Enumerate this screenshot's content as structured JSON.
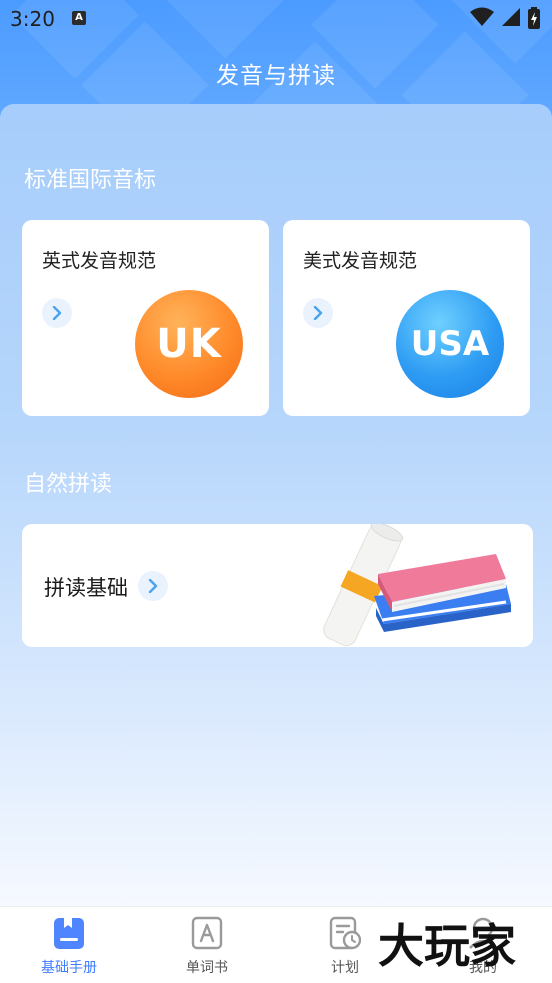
{
  "status_bar": {
    "time": "3:20",
    "notification_icon": "A"
  },
  "header": {
    "title": "发音与拼读"
  },
  "sections": {
    "ipa_title": "标准国际音标",
    "phonics_title": "自然拼读"
  },
  "cards": {
    "uk": {
      "label": "英式发音规范",
      "badge": "UK"
    },
    "usa": {
      "label": "美式发音规范",
      "badge": "USA"
    },
    "phonics": {
      "label": "拼读基础"
    }
  },
  "bottom_nav": {
    "items": [
      {
        "label": "基础手册",
        "icon": "handbook-icon",
        "active": true
      },
      {
        "label": "单词书",
        "icon": "word-book-icon",
        "active": false
      },
      {
        "label": "计划",
        "icon": "plan-icon",
        "active": false
      },
      {
        "label": "我的",
        "icon": "profile-icon",
        "active": false
      }
    ]
  },
  "watermark": "大玩家",
  "colors": {
    "header_blue": "#4b9bff",
    "accent": "#3d7dff",
    "uk_orange": "#ff8a2a",
    "usa_blue": "#2e9cf3"
  }
}
